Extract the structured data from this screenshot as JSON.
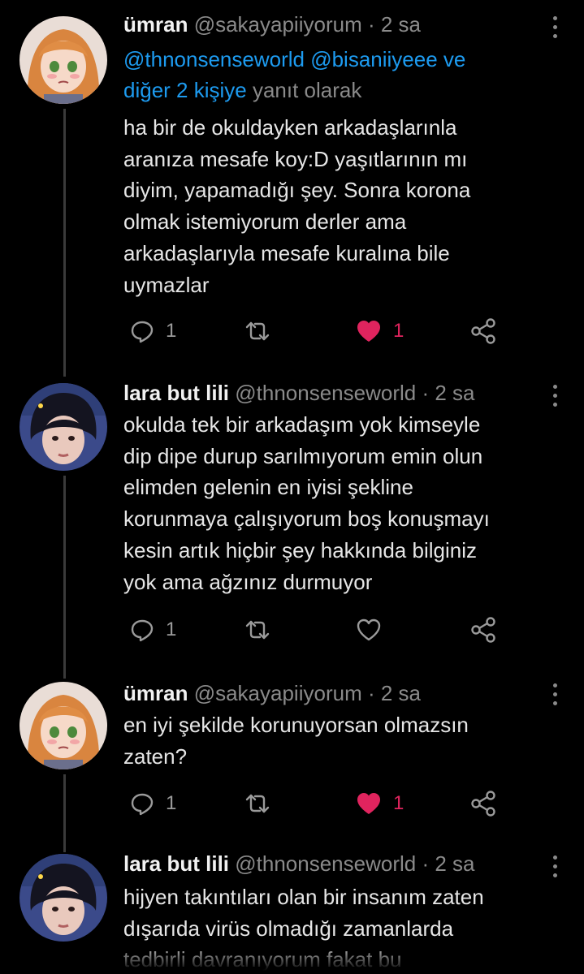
{
  "tweets": [
    {
      "avatar_icon": "anime-girl-avatar",
      "name": "ümran",
      "handle": "@sakayapiiyorum",
      "time": "· 2 sa",
      "reply_line1": "@thnonsenseworld @bisaniiyeee ve",
      "reply_link2": "diğer 2 kişiye",
      "reply_suffix": "yanıt olarak",
      "text": "ha bir de okuldayken arkadaşlarınla\naranıza mesafe koy:D yaşıtlarının mı\ndiyim, yapamadığı şey. Sonra korona\nolmak istemiyorum derler ama\narkadaşlarıyla mesafe kuralına bile\nuymazlar",
      "replies": "1",
      "likes": "1",
      "liked": true
    },
    {
      "avatar_icon": "boy-portrait-avatar",
      "name": "lara but lili",
      "handle": "@thnonsenseworld",
      "time": "· 2 sa",
      "text": "okulda tek bir arkadaşım yok kimseyle\ndip dipe durup sarılmıyorum emin olun\nelimden gelenin en iyisi şekline\nkorunmaya çalışıyorum boş konuşmayı\nkesin artık hiçbir şey hakkında bilginiz\nyok ama ağzınız durmuyor",
      "replies": "1",
      "likes": "",
      "liked": false
    },
    {
      "avatar_icon": "anime-girl-avatar",
      "name": "ümran",
      "handle": "@sakayapiiyorum",
      "time": "· 2 sa",
      "text": "en iyi şekilde korunuyorsan olmazsın\nzaten?",
      "replies": "1",
      "likes": "1",
      "liked": true
    },
    {
      "avatar_icon": "boy-portrait-avatar",
      "name": "lara but lili",
      "handle": "@thnonsenseworld",
      "time": "· 2 sa",
      "text": "hijyen takıntıları olan bir insanım zaten\ndışarıda virüs olmadığı zamanlarda\ntedbirli davranıyorum fakat bu"
    }
  ],
  "colors": {
    "background": "#000000",
    "link": "#1d9bf0",
    "like": "#e0245e",
    "muted": "#8a8a8a"
  }
}
